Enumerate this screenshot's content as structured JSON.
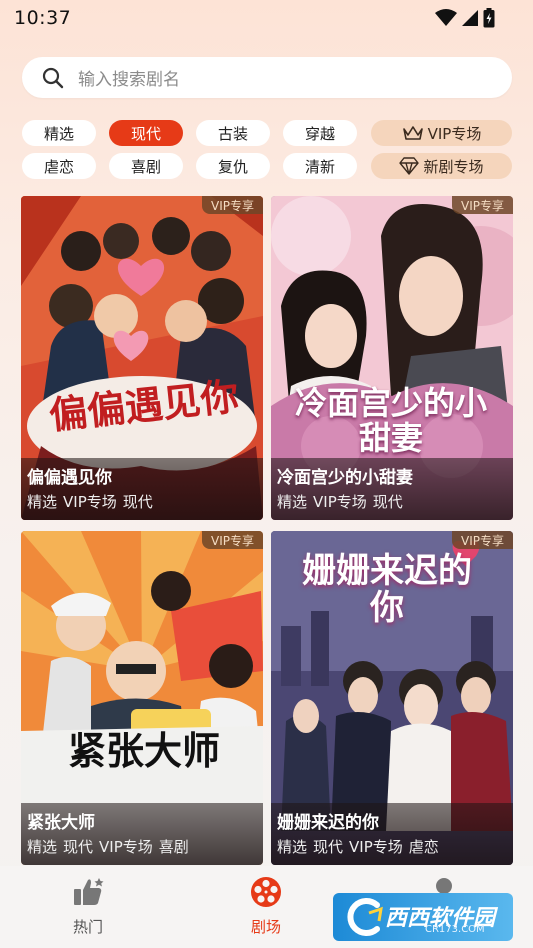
{
  "status_bar": {
    "time": "10:37"
  },
  "search": {
    "placeholder": "输入搜索剧名"
  },
  "categories": {
    "row1": [
      "精选",
      "现代",
      "古装",
      "穿越",
      "VIP专场"
    ],
    "row2": [
      "虐恋",
      "喜剧",
      "复仇",
      "清新",
      "新剧专场"
    ],
    "active": "现代"
  },
  "cards": [
    {
      "title": "偏偏遇见你",
      "tags": [
        "精选",
        "VIP专场",
        "现代"
      ],
      "badge": "VIP专享",
      "poster_title": "偏偏遇见你"
    },
    {
      "title": "冷面宫少的小甜妻",
      "tags": [
        "精选",
        "VIP专场",
        "现代"
      ],
      "badge": "VIP专享",
      "poster_title": "冷面宫少的小甜妻"
    },
    {
      "title": "紧张大师",
      "tags": [
        "精选",
        "现代",
        "VIP专场",
        "喜剧"
      ],
      "badge": "VIP专享",
      "poster_title": "紧张大师"
    },
    {
      "title": "姗姗来迟的你",
      "tags": [
        "精选",
        "现代",
        "VIP专场",
        "虐恋"
      ],
      "badge": "VIP专享",
      "poster_title": "姗姗来迟的你"
    }
  ],
  "bottom_nav": {
    "items": [
      {
        "label": "热门",
        "icon": "thumbs-up-icon",
        "active": false
      },
      {
        "label": "剧场",
        "icon": "film-reel-icon",
        "active": true
      },
      {
        "label": "",
        "icon": "user-icon",
        "active": false
      }
    ]
  },
  "watermark": {
    "text": "西西软件园",
    "sub": "CR173.COM"
  },
  "colors": {
    "accent": "#e63a17",
    "vip_chip": "#f5d5bc",
    "nav_active": "#e63a17"
  }
}
